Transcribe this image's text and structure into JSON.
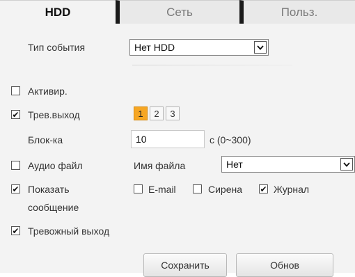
{
  "tabs": [
    {
      "label": "HDD",
      "active": true
    },
    {
      "label": "Сеть",
      "active": false
    },
    {
      "label": "Польз.",
      "active": false
    }
  ],
  "event_type": {
    "label": "Тип события",
    "value": "Нет HDD"
  },
  "enable": {
    "label": "Активир.",
    "checked": false
  },
  "alarm_out": {
    "label": "Трев.выход",
    "checked": true,
    "channels": [
      "1",
      "2",
      "3"
    ],
    "selected": "1"
  },
  "latch": {
    "label": "Блок-ка",
    "value": "10",
    "unit": "с (0~300)"
  },
  "audio": {
    "label": "Аудио файл",
    "file_label": "Имя файла",
    "file_value": "Нет",
    "checked": false
  },
  "show_message": {
    "label_line1": "Показать",
    "label_line2": "сообщение",
    "checked": true
  },
  "email": {
    "label": "E-mail",
    "checked": false
  },
  "siren": {
    "label": "Сирена",
    "checked": false
  },
  "log": {
    "label": "Журнал",
    "checked": true
  },
  "alarm_upload": {
    "label": "Тревожный выход",
    "checked": true
  },
  "buttons": {
    "save": "Сохранить",
    "refresh": "Обнов"
  },
  "colors": {
    "accent": "#f6a623",
    "panel": "#f3f3f3"
  }
}
